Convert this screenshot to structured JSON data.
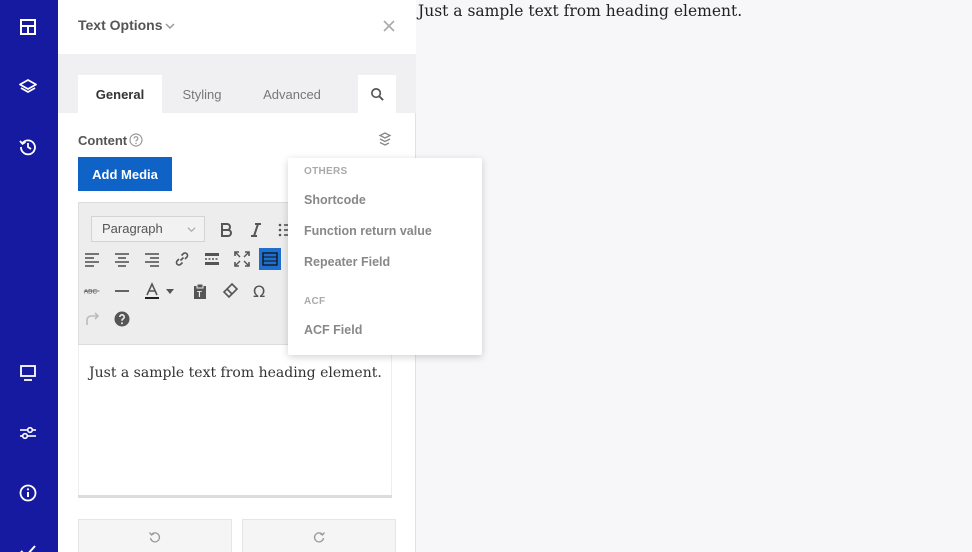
{
  "leftbar": {
    "icons_top": [
      "layout-icon",
      "layers-icon",
      "history-icon"
    ],
    "icons_bottom": [
      "desktop-icon",
      "sliders-icon",
      "info-icon",
      "check-icon"
    ]
  },
  "panel": {
    "title": "Text Options",
    "tabs": [
      {
        "label": "General",
        "active": true
      },
      {
        "label": "Styling",
        "active": false
      },
      {
        "label": "Advanced",
        "active": false
      }
    ],
    "content_label": "Content",
    "add_media_label": "Add Media",
    "editor": {
      "paragraph_select": "Paragraph",
      "text": "Just a sample text from heading element."
    }
  },
  "dropdown": {
    "groups": [
      {
        "name": "OTHERS",
        "items": [
          "Shortcode",
          "Function return value",
          "Repeater Field"
        ]
      },
      {
        "name": "ACF",
        "items": [
          "ACF Field"
        ]
      }
    ]
  },
  "canvas": {
    "heading_text": "Just a sample text from heading element."
  },
  "colors": {
    "sidebar": "#151aa0",
    "accent": "#0f63c7"
  }
}
